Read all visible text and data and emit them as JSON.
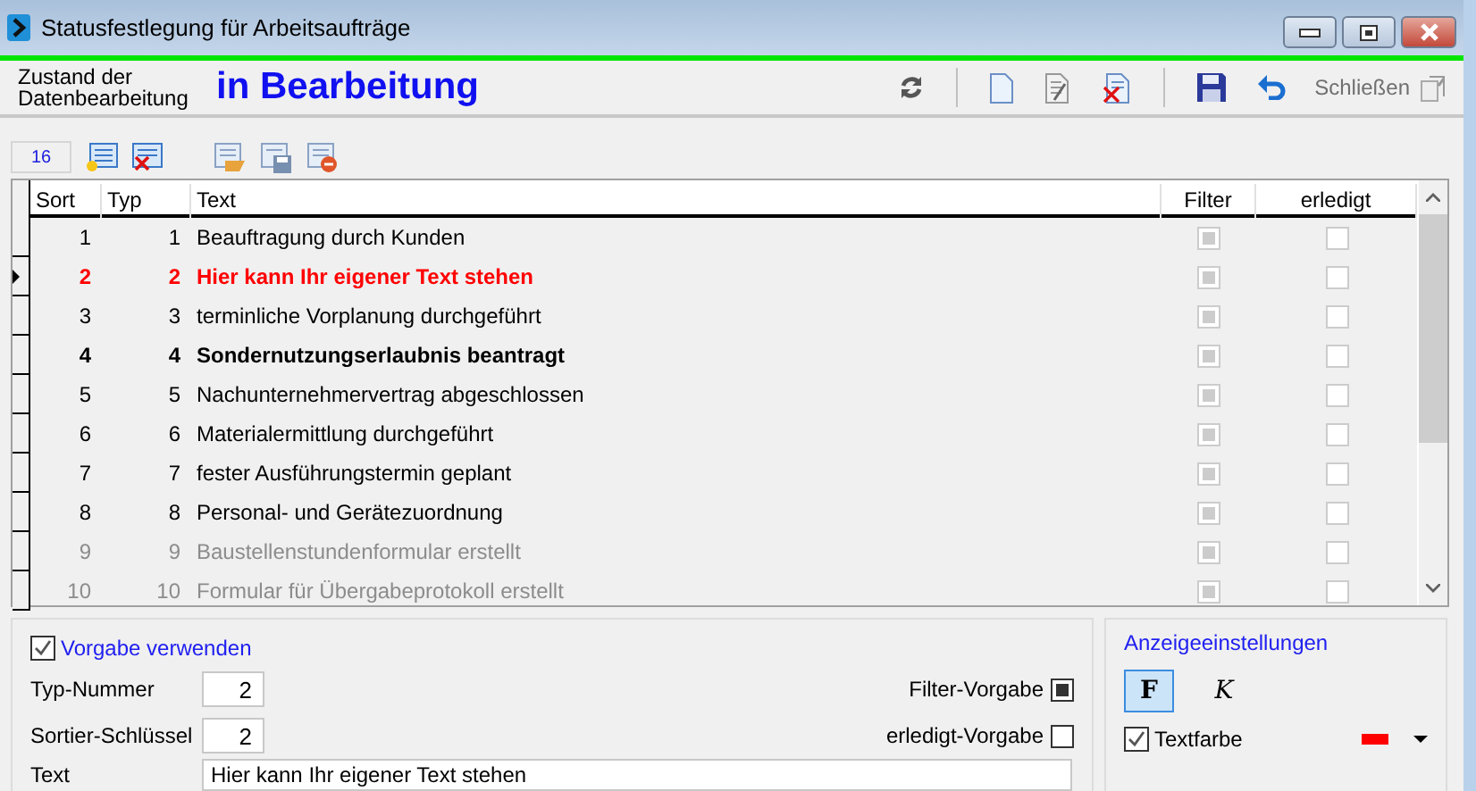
{
  "window": {
    "title": "Statusfestlegung für Arbeitsaufträge"
  },
  "header": {
    "state_label": "Zustand der Datenbearbeitung",
    "state_value": "in Bearbeitung",
    "tools": [
      {
        "kind": "refresh"
      },
      {
        "kind": "separator"
      },
      {
        "kind": "new"
      },
      {
        "kind": "edit"
      },
      {
        "kind": "delete"
      },
      {
        "kind": "separator"
      },
      {
        "kind": "save"
      },
      {
        "kind": "undo"
      }
    ],
    "close_label": "Schließen"
  },
  "grid_toolbar": {
    "count": "16",
    "tools": [
      {
        "kind": "add-row"
      },
      {
        "kind": "remove-row"
      },
      {
        "kind": "gap"
      },
      {
        "kind": "open"
      },
      {
        "kind": "save-table"
      },
      {
        "kind": "delete-table"
      }
    ]
  },
  "table": {
    "columns": [
      "Sort",
      "Typ",
      "Text",
      "Filter",
      "erledigt"
    ],
    "rows": [
      {
        "sort": "1",
        "typ": "1",
        "text": "Beauftragung durch Kunden",
        "color": "#000000",
        "bold": false,
        "selected": false,
        "filter": true,
        "done": false
      },
      {
        "sort": "2",
        "typ": "2",
        "text": "Hier kann Ihr eigener Text stehen",
        "color": "#ff0000",
        "bold": true,
        "selected": true,
        "filter": true,
        "done": false
      },
      {
        "sort": "3",
        "typ": "3",
        "text": "terminliche Vorplanung durchgeführt",
        "color": "#000000",
        "bold": false,
        "selected": false,
        "filter": true,
        "done": false
      },
      {
        "sort": "4",
        "typ": "4",
        "text": "Sondernutzungserlaubnis beantragt",
        "color": "#000000",
        "bold": true,
        "selected": false,
        "filter": true,
        "done": false
      },
      {
        "sort": "5",
        "typ": "5",
        "text": "Nachunternehmervertrag abgeschlossen",
        "color": "#000000",
        "bold": false,
        "selected": false,
        "filter": true,
        "done": false
      },
      {
        "sort": "6",
        "typ": "6",
        "text": "Materialermittlung durchgeführt",
        "color": "#000000",
        "bold": false,
        "selected": false,
        "filter": true,
        "done": false
      },
      {
        "sort": "7",
        "typ": "7",
        "text": "fester Ausführungstermin geplant",
        "color": "#000000",
        "bold": false,
        "selected": false,
        "filter": true,
        "done": false
      },
      {
        "sort": "8",
        "typ": "8",
        "text": "Personal- und Gerätezuordnung",
        "color": "#000000",
        "bold": false,
        "selected": false,
        "filter": true,
        "done": false
      },
      {
        "sort": "9",
        "typ": "9",
        "text": "Baustellenstundenformular erstellt",
        "color": "#8c8c8c",
        "bold": false,
        "selected": false,
        "filter": true,
        "done": false
      },
      {
        "sort": "10",
        "typ": "10",
        "text": "Formular für Übergabeprotokoll erstellt",
        "color": "#8c8c8c",
        "bold": false,
        "selected": false,
        "filter": true,
        "done": false
      }
    ]
  },
  "defaults": {
    "use_default": {
      "label": "Vorgabe verwenden",
      "checked": true
    },
    "fields": [
      {
        "label": "Typ-Nummer",
        "value": "2"
      },
      {
        "label": "Sortier-Schlüssel",
        "value": "2"
      }
    ],
    "flags": [
      {
        "label": "Filter-Vorgabe",
        "checked": true
      },
      {
        "label": "erledigt-Vorgabe",
        "checked": false
      }
    ],
    "text_field": {
      "label": "Text",
      "value": "Hier kann Ihr eigener Text stehen"
    }
  },
  "display": {
    "title": "Anzeigeeinstellungen",
    "styles": [
      {
        "kind": "bold",
        "label": "F",
        "selected": true
      },
      {
        "kind": "italic",
        "label": "K",
        "selected": false
      }
    ],
    "text_color": {
      "label": "Textfarbe",
      "checked": true,
      "color": "#ff0000"
    }
  }
}
